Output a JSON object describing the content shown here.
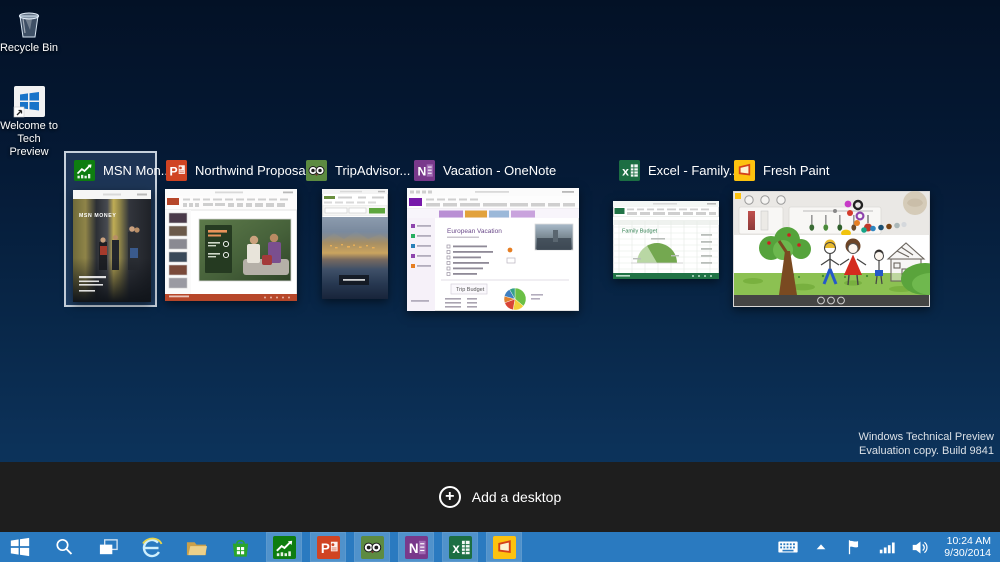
{
  "desktop": {
    "recycle_bin_label": "Recycle Bin",
    "welcome_line1": "Welcome to",
    "welcome_line2": "Tech Preview",
    "watermark_line1": "Windows Technical Preview",
    "watermark_line2": "Evaluation copy. Build 9841"
  },
  "task_view": {
    "add_desktop_label": "Add a desktop",
    "windows": [
      {
        "title": "MSN Mon...",
        "app": "MSN Money",
        "selected": true,
        "content": {
          "header": "MSN MONEY"
        }
      },
      {
        "title": "Northwind Proposa...",
        "app": "PowerPoint",
        "selected": false
      },
      {
        "title": "TripAdvisor...",
        "app": "TripAdvisor",
        "selected": false
      },
      {
        "title": "Vacation - OneNote",
        "app": "OneNote",
        "selected": false,
        "content": {
          "heading": "European Vacation",
          "budget_title": "Trip Budget"
        }
      },
      {
        "title": "Excel - Family...",
        "app": "Excel",
        "selected": false,
        "content": {
          "heading": "Family Budget"
        }
      },
      {
        "title": "Fresh Paint",
        "app": "Fresh Paint",
        "selected": false
      }
    ]
  },
  "taskbar": {
    "icons": [
      "start",
      "search",
      "task-view",
      "internet-explorer",
      "file-explorer",
      "store",
      "msn-money",
      "powerpoint",
      "tripadvisor",
      "onenote",
      "excel",
      "fresh-paint"
    ]
  },
  "tray": {
    "icons": [
      "keyboard",
      "show-hidden-chevron",
      "action-center-flag",
      "network-signal",
      "volume"
    ],
    "time": "10:24 AM",
    "date": "9/30/2014"
  },
  "colors": {
    "taskbar_blue": "#2a7ac0",
    "strip_dark": "#1e1e1e",
    "selection_border": "#c7d1dc",
    "desktop_top": "#031126",
    "desktop_bottom": "#0e3a66"
  }
}
